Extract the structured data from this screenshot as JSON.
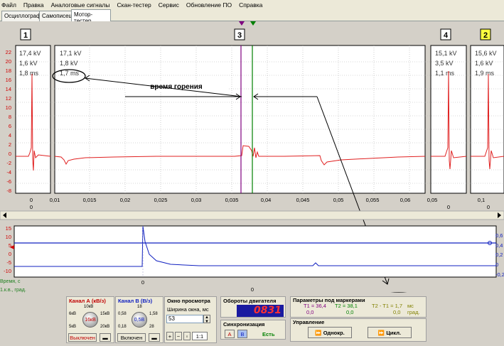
{
  "menu": [
    "Файл",
    "Правка",
    "Аналоговые сигналы",
    "Скан-тестер",
    "Сервис",
    "Обновление ПО",
    "Справка"
  ],
  "tabs": [
    "Осциллограф",
    "Самописец",
    "Мотор-тестер"
  ],
  "active_tab": "Мотор-тестер",
  "colors": {
    "red_trace": "#e02020",
    "blue_trace": "#1020c0",
    "marker_t1": "#800080",
    "marker_t2": "#008000",
    "cyl_yellow": "#ffff40"
  },
  "cylinders": [
    {
      "num": "1",
      "kv": "17,4 kV",
      "kv2": "1,6 kV",
      "ms": "1,8 ms"
    },
    {
      "num": "3",
      "kv": "17,1 kV",
      "kv2": "1,8 kV",
      "ms": "1,7 ms"
    },
    {
      "num": "4",
      "kv": "15,1 kV",
      "kv2": "3,5 kV",
      "ms": "1,1 ms"
    },
    {
      "num": "2",
      "kv": "15,6 kV",
      "kv2": "1,6 kV",
      "ms": "1,9 ms"
    }
  ],
  "annotation": "время горения",
  "top_y_ticks": [
    "22",
    "20",
    "18",
    "16",
    "14",
    "12",
    "10",
    "8",
    "6",
    "4",
    "2",
    "0",
    "-2",
    "-4",
    "-6",
    "-8"
  ],
  "x_ticks": [
    "0",
    "0,01",
    "0,015",
    "0,02",
    "0,025",
    "0,03",
    "0,035",
    "0,04",
    "0,045",
    "0,05",
    "0,055",
    "0,06",
    "0,05",
    "0,1"
  ],
  "x_ticks_second_row": [
    "0",
    "0",
    "0"
  ],
  "bottom_y_ticks": [
    "15",
    "10",
    "5",
    "0",
    "-5",
    "-10"
  ],
  "right_y_ticks": [
    "0,6",
    "0,4",
    "0,2",
    "0",
    "-0,2"
  ],
  "bottom_x_tick": "0",
  "axis_labels": {
    "time": "Время, с",
    "angle": "1.к.в., град."
  },
  "scroll_x_tick": "0",
  "controls": {
    "channel_a_title": "Канал А (кВ/з)",
    "channel_a_scales": [
      "10кВ",
      "6кВ",
      "15кВ",
      "5кВ",
      "20кВ"
    ],
    "channel_a_knob": "16кВ",
    "channel_a_button": "Выключен",
    "channel_b_title": "Канал В (В/з)",
    "channel_b_scales": [
      "18",
      "0,58",
      "1,58",
      "0,18",
      "28"
    ],
    "channel_b_knob": "0,5В",
    "channel_b_button": "Включен",
    "view_title": "Окно просмотра",
    "view_width_label": "Ширина окна, мс",
    "view_width_value": "53",
    "zoom_value": "1:1",
    "rpm_title": "Обороты двигателя",
    "rpm_value": "0831",
    "sync_title": "Синхронизация",
    "sync_a": "A",
    "sync_b": "B",
    "sync_status": "Есть",
    "markers_title": "Параметры под маркерами",
    "t1_label": "T1 = 36,4",
    "t1_val": "0,0",
    "t2_label": "T2 = 38,1",
    "t2_val": "0,0",
    "dt_label": "T2 - T1 = 1,7",
    "dt_unit": "мс",
    "dt_val": "0,0",
    "dt_unit2": "град.",
    "control_title": "Управление",
    "single_button": "Однокр.",
    "cycle_button": "Цикл."
  }
}
